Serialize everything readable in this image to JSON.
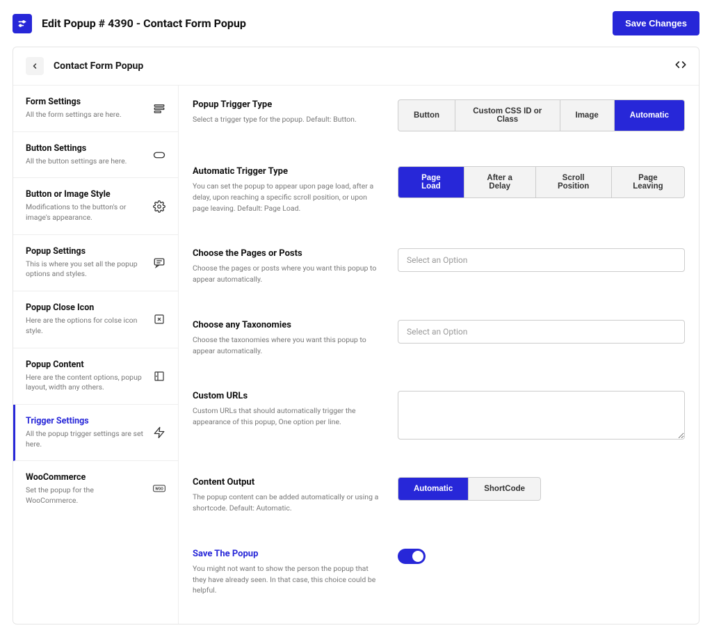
{
  "header": {
    "title": "Edit Popup # 4390 - Contact Form Popup",
    "save_label": "Save Changes"
  },
  "panel": {
    "title": "Contact Form Popup"
  },
  "sidebar": {
    "items": [
      {
        "title": "Form Settings",
        "desc": "All the form settings are here."
      },
      {
        "title": "Button Settings",
        "desc": "All the button settings are here."
      },
      {
        "title": "Button or Image Style",
        "desc": "Modifications to the button's or image's appearance."
      },
      {
        "title": "Popup Settings",
        "desc": "This is where you set all the popup options and styles."
      },
      {
        "title": "Popup Close Icon",
        "desc": "Here are the options for colse icon style."
      },
      {
        "title": "Popup Content",
        "desc": "Here are the content options, popup layout, width any others."
      },
      {
        "title": "Trigger Settings",
        "desc": "All the popup trigger settings are set here."
      },
      {
        "title": "WooCommerce",
        "desc": "Set the popup for the WooCommerce."
      }
    ]
  },
  "fields": {
    "trigger_type": {
      "label": "Popup Trigger Type",
      "desc": "Select a trigger type for the popup. Default: Button.",
      "options": [
        "Button",
        "Custom CSS ID or Class",
        "Image",
        "Automatic"
      ],
      "selected": "Automatic"
    },
    "auto_trigger": {
      "label": "Automatic Trigger Type",
      "desc": "You can set the popup to appear upon page load, after a delay, upon reaching a specific scroll position, or upon page leaving. Default: Page Load.",
      "options": [
        "Page Load",
        "After a Delay",
        "Scroll Position",
        "Page Leaving"
      ],
      "selected": "Page Load"
    },
    "pages": {
      "label": "Choose the Pages or Posts",
      "desc": "Choose the pages or posts where you want this popup to appear automatically.",
      "placeholder": "Select an Option"
    },
    "taxonomies": {
      "label": "Choose any Taxonomies",
      "desc": "Choose the taxonomies where you want this popup to appear automatically.",
      "placeholder": "Select an Option"
    },
    "custom_urls": {
      "label": "Custom URLs",
      "desc": "Custom URLs that should automatically trigger the appearance of this popup, One option per line."
    },
    "content_output": {
      "label": "Content Output",
      "desc": "The popup content can be added automatically or using a shortcode. Default: Automatic.",
      "options": [
        "Automatic",
        "ShortCode"
      ],
      "selected": "Automatic"
    },
    "save_popup": {
      "label": "Save The Popup",
      "desc": "You might not want to show the person the popup that they have already seen. In that case, this choice could be helpful.",
      "value": true
    }
  }
}
